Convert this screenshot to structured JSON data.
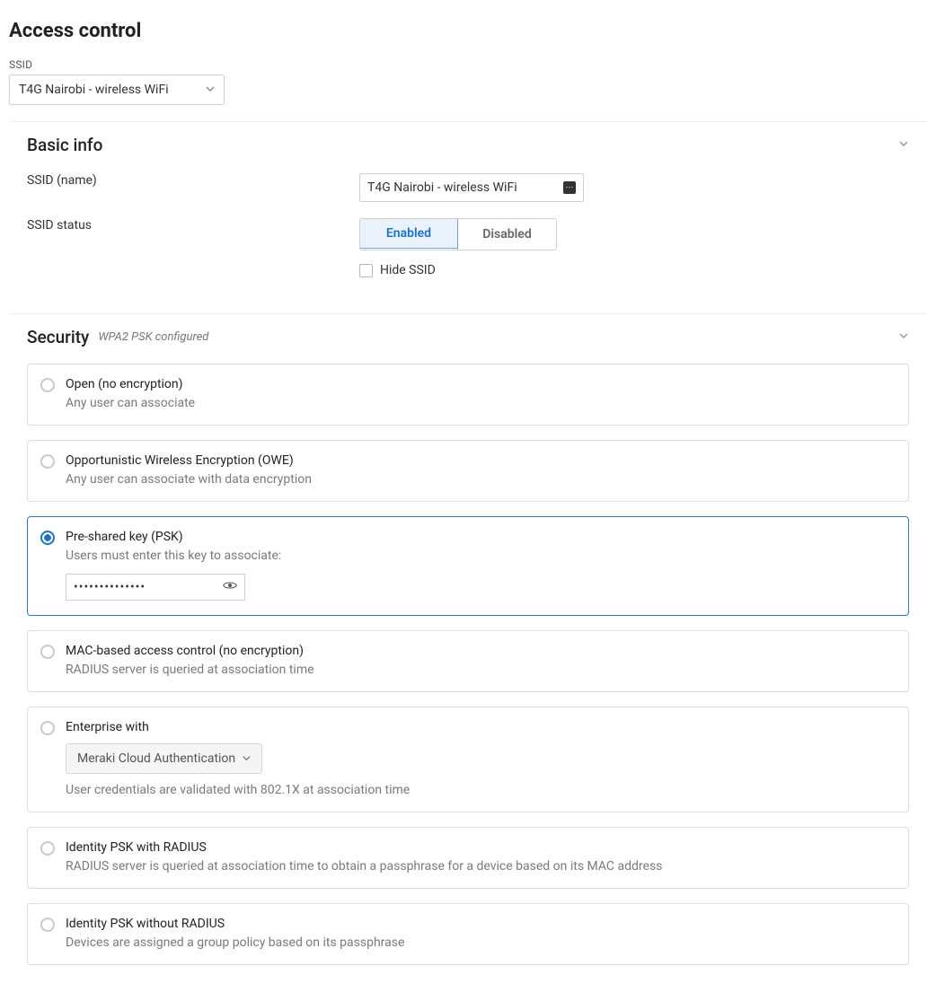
{
  "page_title": "Access control",
  "ssid_picker": {
    "label": "SSID",
    "selected": "T4G Nairobi - wireless WiFi"
  },
  "basic": {
    "title": "Basic info",
    "name_label": "SSID (name)",
    "name_value": "T4G Nairobi - wireless WiFi",
    "status_label": "SSID status",
    "enabled_label": "Enabled",
    "disabled_label": "Disabled",
    "hide_ssid_label": "Hide SSID"
  },
  "security": {
    "title": "Security",
    "subtitle": "WPA2 PSK configured",
    "options": {
      "open_title": "Open (no encryption)",
      "open_desc": "Any user can associate",
      "owe_title": "Opportunistic Wireless Encryption (OWE)",
      "owe_desc": "Any user can associate with data encryption",
      "psk_title": "Pre-shared key (PSK)",
      "psk_desc": "Users must enter this key to associate:",
      "psk_value_masked": "••••••••••••••",
      "mac_title": "MAC-based access control (no encryption)",
      "mac_desc": "RADIUS server is queried at association time",
      "ent_title": "Enterprise with",
      "ent_auth_label": "Meraki Cloud Authentication",
      "ent_desc": "User credentials are validated with 802.1X at association time",
      "ipsk_radius_title": "Identity PSK with RADIUS",
      "ipsk_radius_desc": "RADIUS server is queried at association time to obtain a passphrase for a device based on its MAC address",
      "ipsk_noradius_title": "Identity PSK without RADIUS",
      "ipsk_noradius_desc": "Devices are assigned a group policy based on its passphrase"
    }
  }
}
